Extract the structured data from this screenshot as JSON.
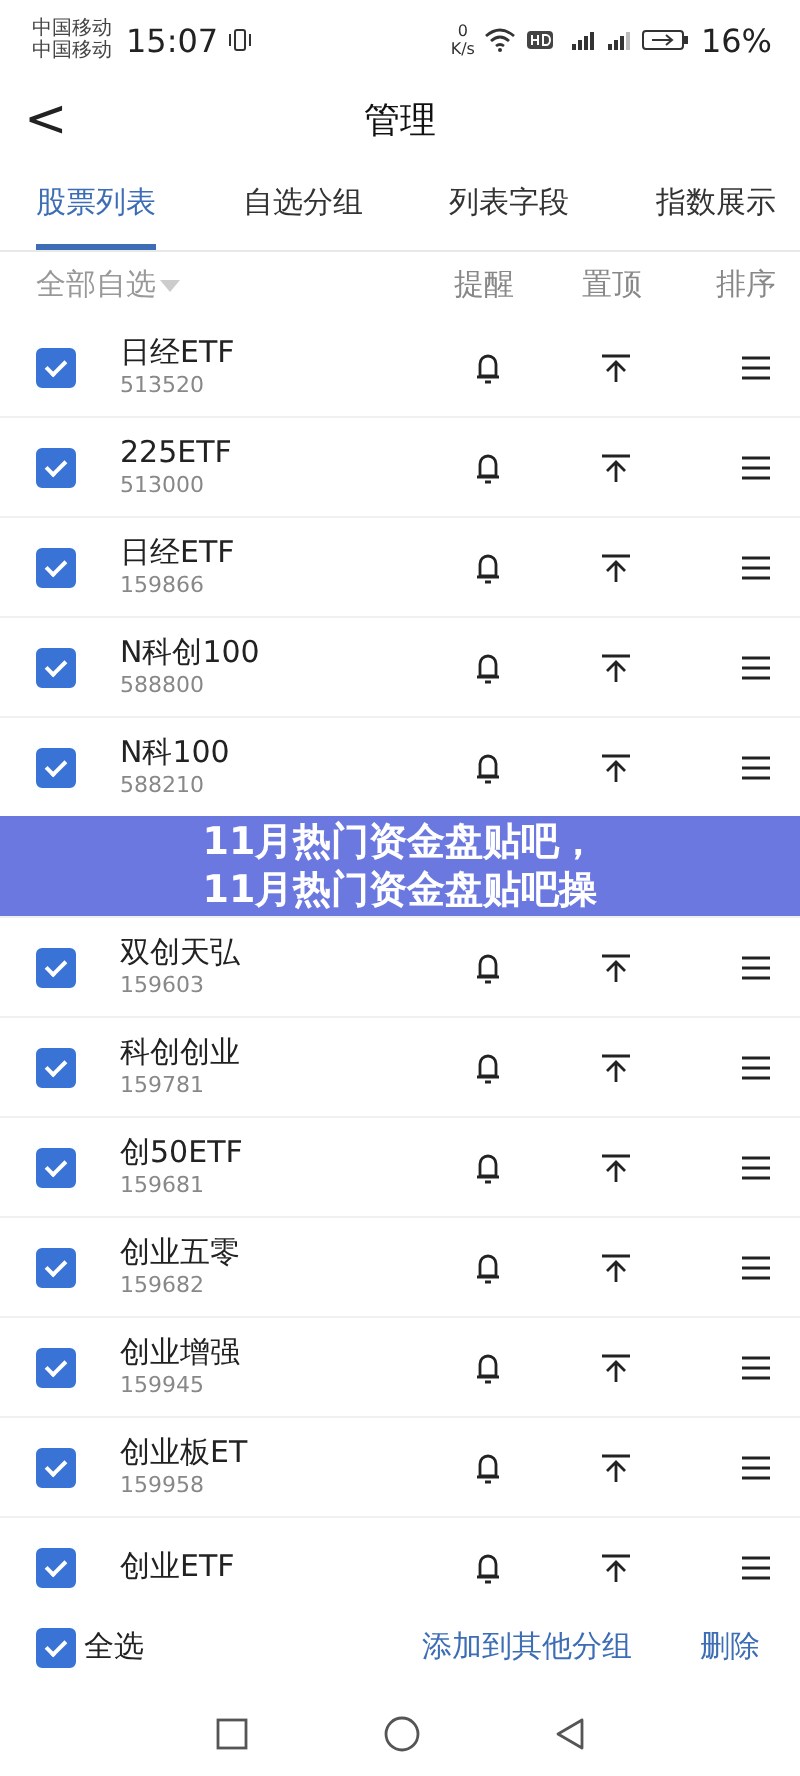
{
  "status_bar": {
    "carriers": [
      "中国移动",
      "中国移动"
    ],
    "time": "15:07",
    "speed": [
      "0",
      "K/s"
    ],
    "battery": "16%"
  },
  "header": {
    "back": "<",
    "title": "管理"
  },
  "tabs": [
    {
      "label": "股票列表",
      "selected": true
    },
    {
      "label": "自选分组",
      "selected": false
    },
    {
      "label": "列表字段",
      "selected": false
    },
    {
      "label": "指数展示",
      "selected": false
    }
  ],
  "list_header": {
    "group": "全部自选",
    "columns": [
      "提醒",
      "置顶",
      "排序"
    ]
  },
  "rows": [
    {
      "name": "日经ETF",
      "code": "513520",
      "checked": true
    },
    {
      "name": "225ETF",
      "code": "513000",
      "checked": true
    },
    {
      "name": "日经ETF",
      "code": "159866",
      "checked": true
    },
    {
      "name": "N科创100",
      "code": "588800",
      "checked": true
    },
    {
      "name": "N科100",
      "code": "588210",
      "checked": true
    },
    {
      "kind": "covered"
    },
    {
      "name": "双创天弘",
      "code": "159603",
      "checked": true
    },
    {
      "name": "科创创业",
      "code": "159781",
      "checked": true
    },
    {
      "name": "创50ETF",
      "code": "159681",
      "checked": true
    },
    {
      "name": "创业五零",
      "code": "159682",
      "checked": true
    },
    {
      "name": "创业增强",
      "code": "159945",
      "checked": true
    },
    {
      "name": "创业板ET",
      "code": "159958",
      "checked": true
    },
    {
      "name": "创业ETF",
      "checked": true
    }
  ],
  "bottom_bar": {
    "select_all": {
      "label": "全选",
      "checked": true
    },
    "actions": [
      "添加到其他分组",
      "删除"
    ]
  },
  "banner": {
    "lines": [
      "11月热门资金盘贴吧，",
      "11月热门资金盘贴吧操"
    ]
  }
}
